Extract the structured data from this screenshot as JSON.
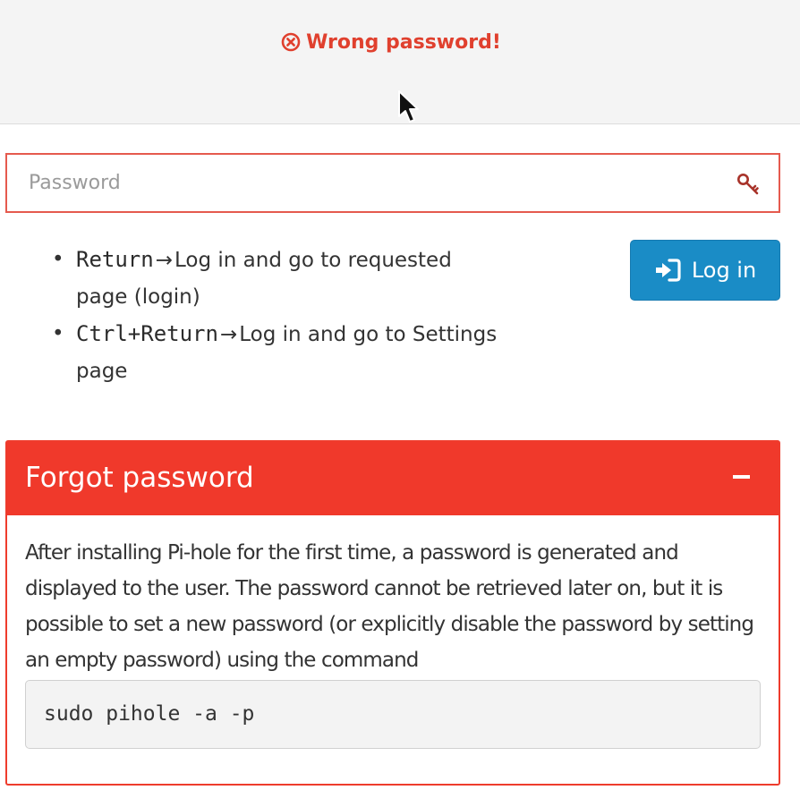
{
  "error": {
    "message": "Wrong password!",
    "icon": "circle-x-icon",
    "color": "#e0402e"
  },
  "login_form": {
    "password_placeholder": "Password",
    "password_value": "",
    "key_icon": "key-icon",
    "button_label": "Log in",
    "button_icon": "sign-in-icon",
    "button_color": "#1a8cc6"
  },
  "hints": [
    {
      "key": "Return",
      "arrow": "→",
      "description": "Log in and go to requested page (login)"
    },
    {
      "key": "Ctrl+Return",
      "arrow": "→",
      "description": "Log in and go to Settings page"
    }
  ],
  "forgot_panel": {
    "title": "Forgot password",
    "header_color": "#f0392b",
    "collapse_icon": "minus-icon",
    "body_text": "After installing Pi-hole for the first time, a password is generated and displayed to the user. The password cannot be retrieved later on, but it is possible to set a new password (or explicitly disable the password by setting an empty password) using the command",
    "command": "sudo pihole -a -p"
  }
}
